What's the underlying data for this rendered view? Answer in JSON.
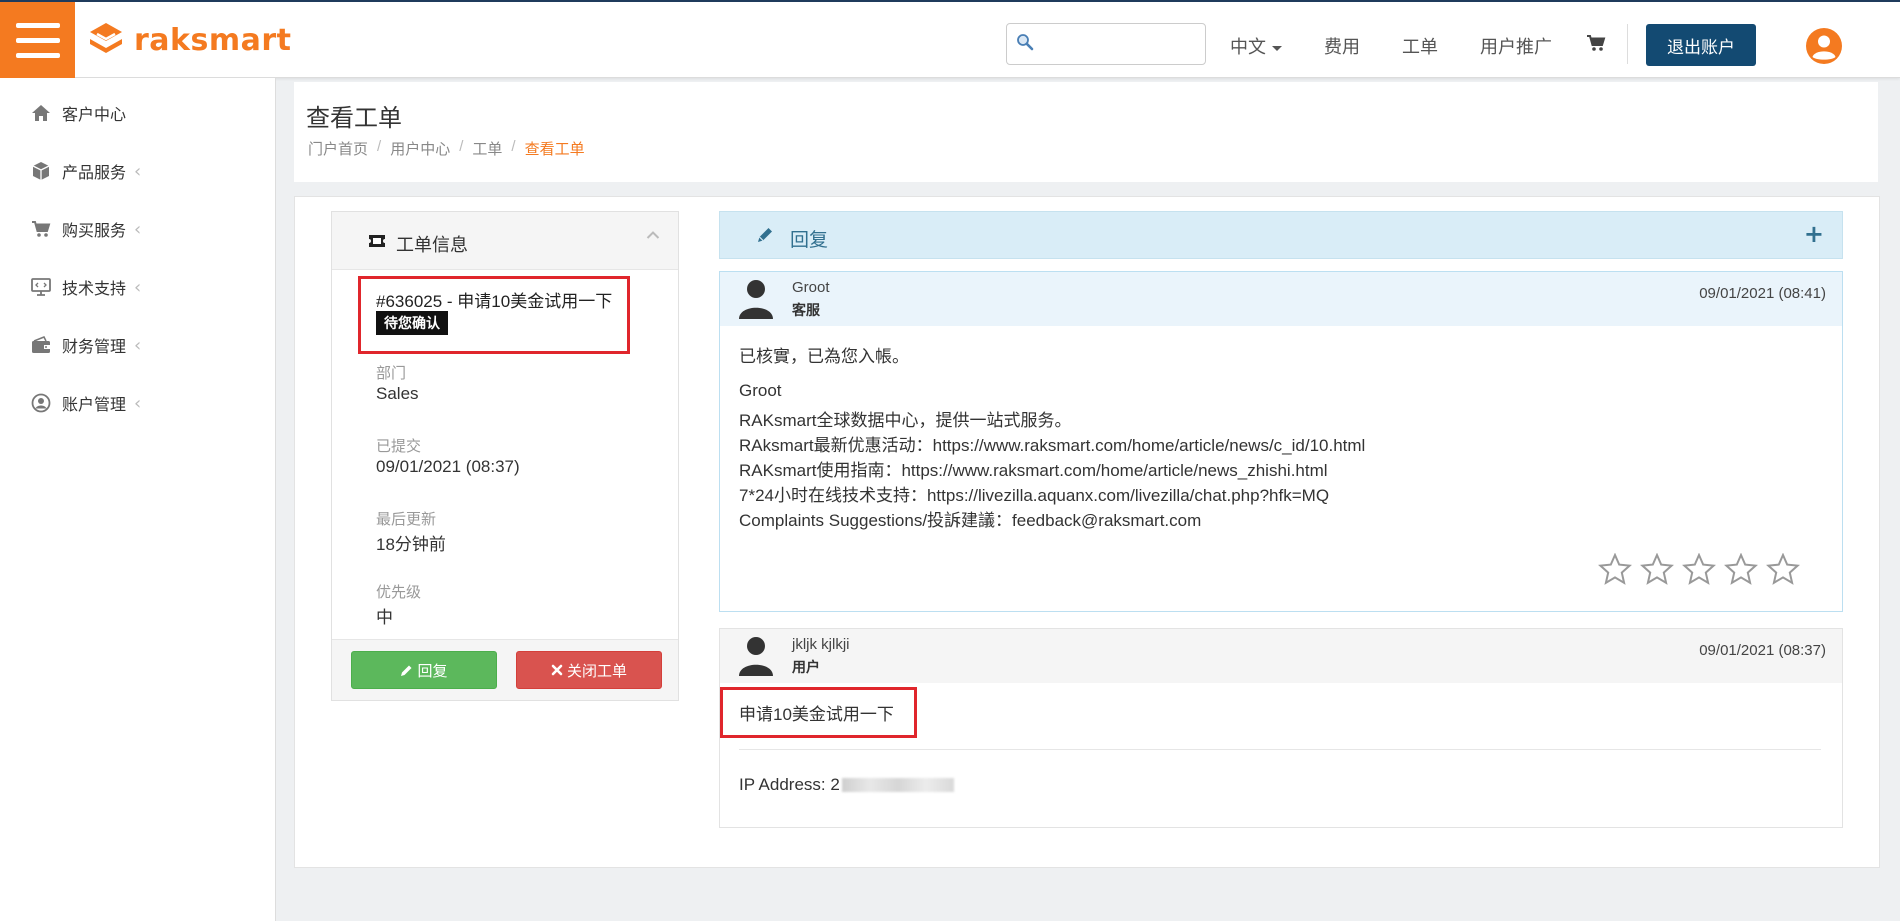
{
  "brand": {
    "name": "raksmart",
    "color": "#f47a20"
  },
  "topnav": {
    "search_placeholder": "",
    "language": "中文",
    "links": [
      "费用",
      "工单",
      "用户推广"
    ],
    "logout_label": "退出账户"
  },
  "sidebar": {
    "items": [
      {
        "label": "客户中心",
        "icon": "home-icon"
      },
      {
        "label": "产品服务",
        "icon": "box-icon"
      },
      {
        "label": "购买服务",
        "icon": "cart-icon"
      },
      {
        "label": "技术支持",
        "icon": "monitor-icon"
      },
      {
        "label": "财务管理",
        "icon": "wallet-icon"
      },
      {
        "label": "账户管理",
        "icon": "user-circle-icon"
      }
    ],
    "chevron": "‹"
  },
  "page": {
    "title": "查看工单",
    "breadcrumb": [
      "门户首页",
      "用户中心",
      "工单",
      "查看工单"
    ]
  },
  "ticket_info": {
    "header": "工单信息",
    "title": "#636025 - 申请10美金试用一下",
    "status": "待您确认",
    "fields": [
      {
        "label": "部门",
        "value": "Sales"
      },
      {
        "label": "已提交",
        "value": "09/01/2021 (08:37)"
      },
      {
        "label": "最后更新",
        "value": "18分钟前"
      },
      {
        "label": "优先级",
        "value": "中"
      }
    ],
    "reply_button": "回复",
    "close_button": "关闭工单"
  },
  "reply_bar": {
    "label": "回复",
    "plus": "+"
  },
  "messages": [
    {
      "name": "Groot",
      "role": "客服",
      "time": "09/01/2021 (08:41)",
      "lines": [
        "已核實，已為您入帳。",
        "Groot",
        "RAKsmart全球数据中心，提供一站式服务。",
        "RAksmart最新优惠活动：https://www.raksmart.com/home/article/news/c_id/10.html",
        "RAKsmart使用指南：https://www.raksmart.com/home/article/news_zhishi.html",
        "7*24小时在线技术支持：https://livezilla.aquanx.com/livezilla/chat.php?hfk=MQ",
        "Complaints Suggestions/投訴建議：feedback@raksmart.com"
      ],
      "rating_stars": 5
    },
    {
      "name": "jkljk kjlkji",
      "role": "用户",
      "time": "09/01/2021 (08:37)",
      "body": "申请10美金试用一下",
      "ip_label": "IP Address: 2"
    }
  ],
  "colors": {
    "accent": "#f47a20",
    "navy": "#134a72",
    "success": "#5cb85c",
    "danger": "#d9534f",
    "info_bg": "#d9edf7",
    "highlight": "#e0262c"
  }
}
